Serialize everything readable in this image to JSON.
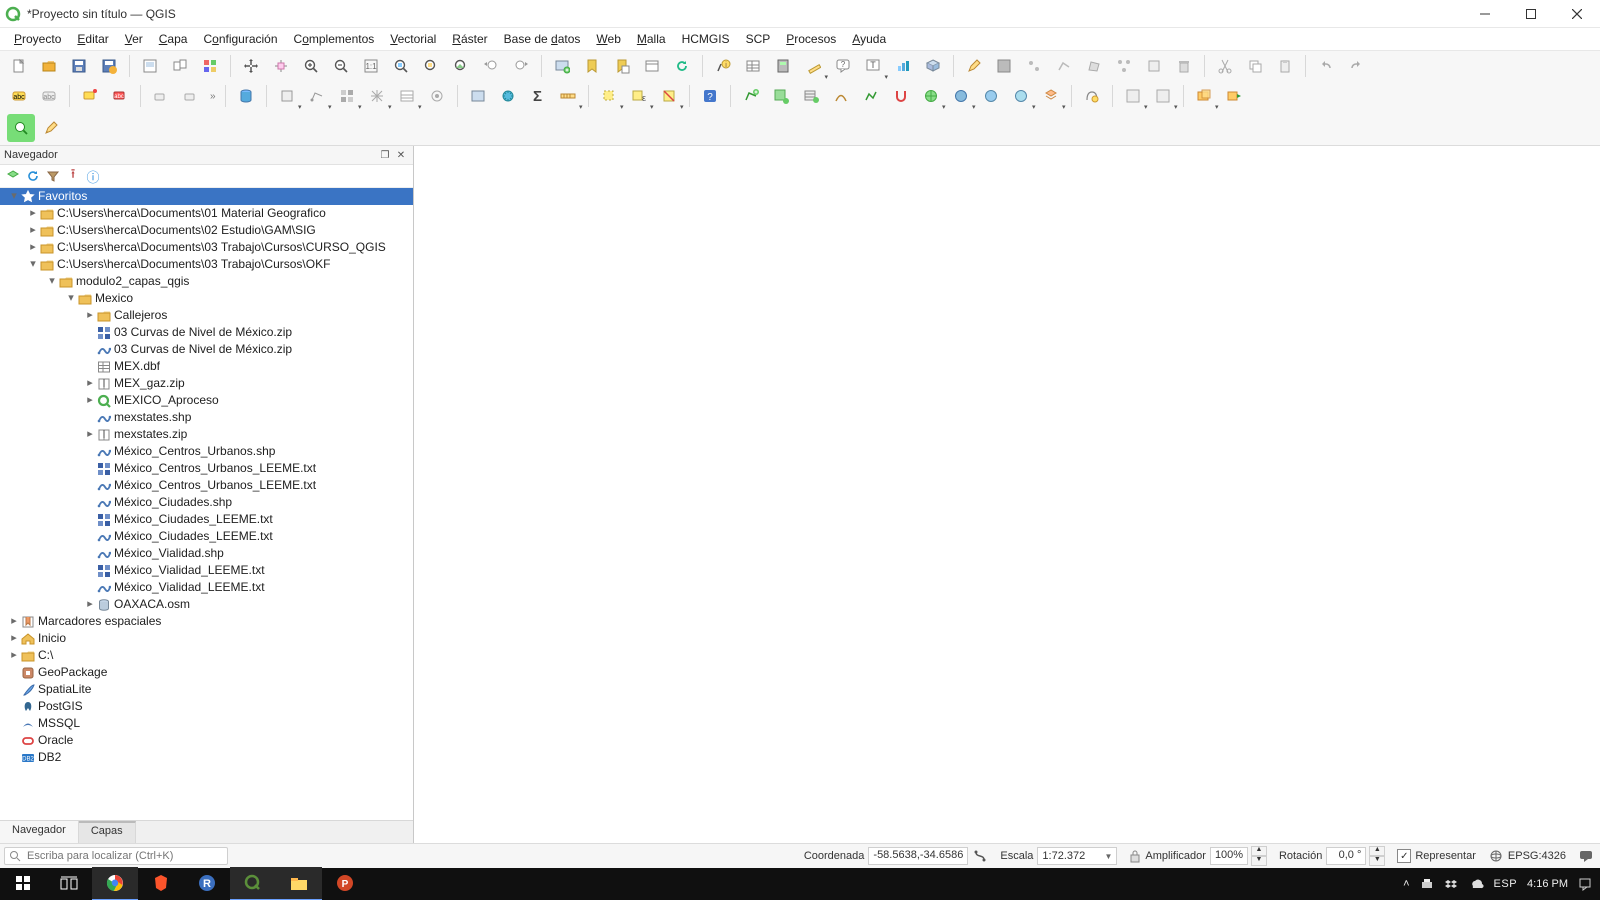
{
  "window": {
    "title": "*Proyecto sin título — QGIS"
  },
  "menu": {
    "items": [
      {
        "label": "Proyecto",
        "u": 0
      },
      {
        "label": "Editar",
        "u": 0
      },
      {
        "label": "Ver",
        "u": 0
      },
      {
        "label": "Capa",
        "u": 0
      },
      {
        "label": "Configuración",
        "u": 1
      },
      {
        "label": "Complementos",
        "u": 1
      },
      {
        "label": "Vectorial",
        "u": 0
      },
      {
        "label": "Ráster",
        "u": 0
      },
      {
        "label": "Base de datos",
        "u": 8
      },
      {
        "label": "Web",
        "u": 0
      },
      {
        "label": "Malla",
        "u": 0
      },
      {
        "label": "HCMGIS",
        "u": -1
      },
      {
        "label": "SCP",
        "u": -1
      },
      {
        "label": "Procesos",
        "u": 0
      },
      {
        "label": "Ayuda",
        "u": 0
      }
    ]
  },
  "panel": {
    "title": "Navegador",
    "tabs": {
      "navegador": "Navegador",
      "capas": "Capas"
    }
  },
  "browser": {
    "items": [
      {
        "depth": 0,
        "tw": "▾",
        "icon": "star",
        "label": "Favoritos",
        "selected": true
      },
      {
        "depth": 1,
        "tw": "▸",
        "icon": "folder",
        "label": "C:\\Users\\herca\\Documents\\01 Material Geografico"
      },
      {
        "depth": 1,
        "tw": "▸",
        "icon": "folder",
        "label": "C:\\Users\\herca\\Documents\\02 Estudio\\GAM\\SIG"
      },
      {
        "depth": 1,
        "tw": "▸",
        "icon": "folder",
        "label": "C:\\Users\\herca\\Documents\\03 Trabajo\\Cursos\\CURSO_QGIS"
      },
      {
        "depth": 1,
        "tw": "▾",
        "icon": "folder",
        "label": "C:\\Users\\herca\\Documents\\03 Trabajo\\Cursos\\OKF"
      },
      {
        "depth": 2,
        "tw": "▾",
        "icon": "folder",
        "label": "modulo2_capas_qgis"
      },
      {
        "depth": 3,
        "tw": "▾",
        "icon": "folder",
        "label": "Mexico"
      },
      {
        "depth": 4,
        "tw": "▸",
        "icon": "folder",
        "label": "Callejeros"
      },
      {
        "depth": 4,
        "tw": " ",
        "icon": "raster",
        "label": "03 Curvas de Nivel de México.zip"
      },
      {
        "depth": 4,
        "tw": " ",
        "icon": "vector",
        "label": "03 Curvas de Nivel de México.zip"
      },
      {
        "depth": 4,
        "tw": " ",
        "icon": "table",
        "label": "MEX.dbf"
      },
      {
        "depth": 4,
        "tw": "▸",
        "icon": "zip",
        "label": "MEX_gaz.zip"
      },
      {
        "depth": 4,
        "tw": "▸",
        "icon": "qgis",
        "label": "MEXICO_Aproceso"
      },
      {
        "depth": 4,
        "tw": " ",
        "icon": "vector",
        "label": "mexstates.shp"
      },
      {
        "depth": 4,
        "tw": "▸",
        "icon": "zip",
        "label": "mexstates.zip"
      },
      {
        "depth": 4,
        "tw": " ",
        "icon": "vector",
        "label": "México_Centros_Urbanos.shp"
      },
      {
        "depth": 4,
        "tw": " ",
        "icon": "raster",
        "label": "México_Centros_Urbanos_LEEME.txt"
      },
      {
        "depth": 4,
        "tw": " ",
        "icon": "vector",
        "label": "México_Centros_Urbanos_LEEME.txt"
      },
      {
        "depth": 4,
        "tw": " ",
        "icon": "vector",
        "label": "México_Ciudades.shp"
      },
      {
        "depth": 4,
        "tw": " ",
        "icon": "raster",
        "label": "México_Ciudades_LEEME.txt"
      },
      {
        "depth": 4,
        "tw": " ",
        "icon": "vector",
        "label": "México_Ciudades_LEEME.txt"
      },
      {
        "depth": 4,
        "tw": " ",
        "icon": "vector",
        "label": "México_Vialidad.shp"
      },
      {
        "depth": 4,
        "tw": " ",
        "icon": "raster",
        "label": "México_Vialidad_LEEME.txt"
      },
      {
        "depth": 4,
        "tw": " ",
        "icon": "vector",
        "label": "México_Vialidad_LEEME.txt"
      },
      {
        "depth": 4,
        "tw": "▸",
        "icon": "db",
        "label": "OAXACA.osm"
      },
      {
        "depth": 0,
        "tw": "▸",
        "icon": "bookmark",
        "label": "Marcadores espaciales"
      },
      {
        "depth": 0,
        "tw": "▸",
        "icon": "home",
        "label": "Inicio"
      },
      {
        "depth": 0,
        "tw": "▸",
        "icon": "folder",
        "label": "C:\\"
      },
      {
        "depth": 0,
        "tw": " ",
        "icon": "gpkg",
        "label": "GeoPackage"
      },
      {
        "depth": 0,
        "tw": " ",
        "icon": "feather",
        "label": "SpatiaLite"
      },
      {
        "depth": 0,
        "tw": " ",
        "icon": "pg",
        "label": "PostGIS"
      },
      {
        "depth": 0,
        "tw": " ",
        "icon": "mssql",
        "label": "MSSQL"
      },
      {
        "depth": 0,
        "tw": " ",
        "icon": "oracle",
        "label": "Oracle"
      },
      {
        "depth": 0,
        "tw": " ",
        "icon": "db2",
        "label": "DB2"
      }
    ]
  },
  "status": {
    "locator_placeholder": "Escriba para localizar (Ctrl+K)",
    "coord_label": "Coordenada",
    "coord_value": "-58.5638,-34.6586",
    "scale_label": "Escala",
    "scale_value": "1:72.372",
    "mag_label": "Amplificador",
    "mag_value": "100%",
    "rot_label": "Rotación",
    "rot_value": "0,0 °",
    "render_label": "Representar",
    "crs": "EPSG:4326"
  },
  "taskbar": {
    "lang": "ESP",
    "time": "4:16 PM"
  }
}
